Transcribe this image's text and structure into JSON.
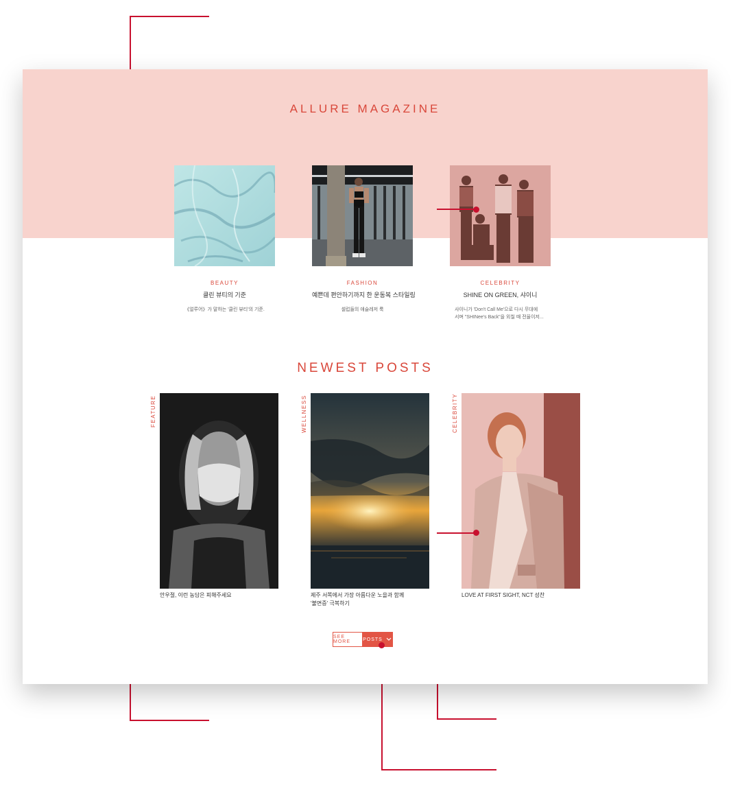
{
  "magazine": {
    "title": "ALLURE MAGAZINE",
    "cards": [
      {
        "category": "BEAUTY",
        "title": "클린 뷰티의 기준",
        "desc": "《얼루어》가 말하는 '클린 뷰티'의 기준."
      },
      {
        "category": "FASHION",
        "title": "예쁜데 편안하기까지 한 운동복 스타일링",
        "desc": "셀럽들의 애슬레저 룩"
      },
      {
        "category": "CELEBRITY",
        "title": "SHINE ON GREEN, 샤이니",
        "desc_line1": "샤이니가 'Don't Call Me'으로 다시 무대에",
        "desc_line2": "서며 \"SHINee's Back\"을 외칠 때 전율이저..."
      }
    ]
  },
  "newest": {
    "title": "NEWEST POSTS",
    "posts": [
      {
        "category": "FEATURE",
        "caption_line1": "안우절, 이런 농담은 피해주세요",
        "caption_line2": ""
      },
      {
        "category": "WELLNESS",
        "caption_line1": "제주 서쪽에서 가장 아름다운 노을과 함께",
        "caption_line2": "'불면증' 극복하기"
      },
      {
        "category": "CELEBRITY",
        "caption_line1": "LOVE AT FIRST SIGHT, NCT 성찬",
        "caption_line2": ""
      }
    ],
    "more_button": {
      "left": "SEE MORE",
      "right": "POSTS",
      "icon": "chevron-down-icon"
    }
  },
  "colors": {
    "accent": "#d9473a",
    "band": "#f8d3cd",
    "annotation": "#c8102e",
    "button": "#e25545"
  }
}
